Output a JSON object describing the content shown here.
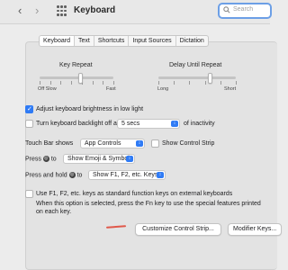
{
  "window": {
    "title": "Keyboard"
  },
  "search": {
    "placeholder": "Search"
  },
  "tabs": [
    "Keyboard",
    "Text",
    "Shortcuts",
    "Input Sources",
    "Dictation"
  ],
  "key_repeat": {
    "title": "Key Repeat",
    "min_labels": "Off  Slow",
    "max_label": "Fast",
    "level": 0.55
  },
  "delay_until_repeat": {
    "title": "Delay Until Repeat",
    "min_label": "Long",
    "max_label": "Short",
    "level": 0.67
  },
  "options": {
    "adjust_brightness": {
      "label": "Adjust keyboard brightness in low light",
      "checked": true
    },
    "backlight_off": {
      "label_before": "Turn keyboard backlight off after",
      "value": "5 secs",
      "label_after": "of inactivity",
      "checked": false
    }
  },
  "touch_bar": {
    "label": "Touch Bar shows",
    "value": "App Controls",
    "control_strip_label": "Show Control Strip"
  },
  "press_globe": {
    "label_before": "Press",
    "label_after": "to",
    "value": "Show Emoji & Symbols"
  },
  "press_hold_globe": {
    "label_before": "Press and hold",
    "label_after": "to",
    "value": "Show F1, F2, etc. Keys"
  },
  "fn_keys": {
    "label": "Use F1, F2, etc. keys as standard function keys on external keyboards",
    "description": "When this option is selected, press the Fn key to use the special features printed on each key."
  },
  "buttons": {
    "customize": "Customize Control Strip...",
    "modifier": "Modifier Keys..."
  },
  "colors": {
    "accent": "#2f7bf5",
    "search_ring": "#6c9fe6",
    "annotation": "#e0584a"
  }
}
